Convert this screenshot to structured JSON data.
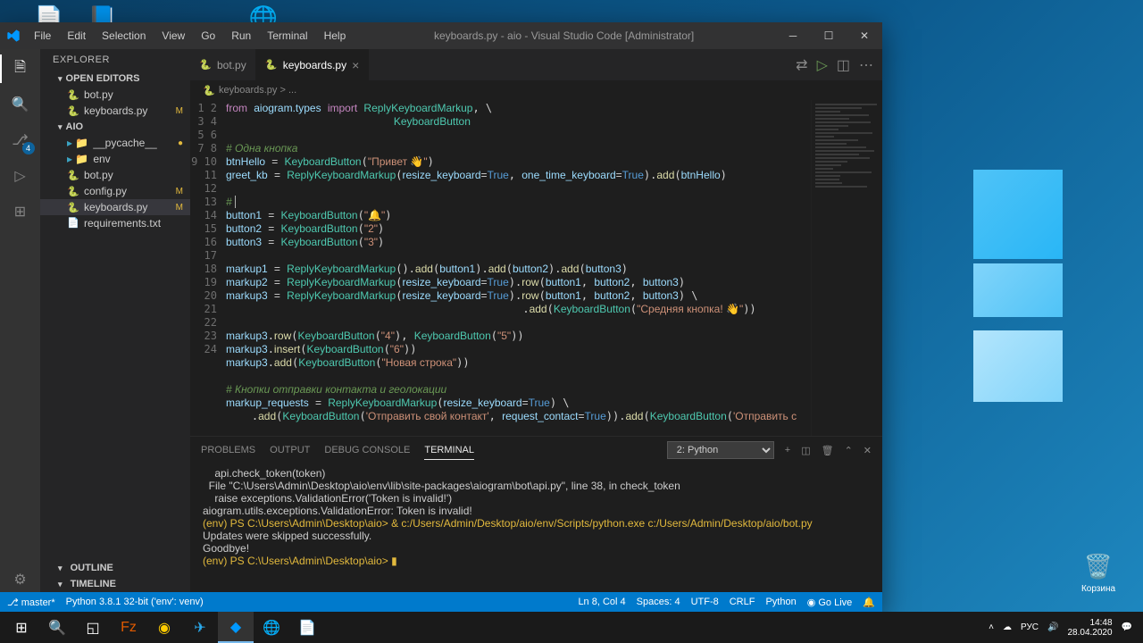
{
  "window": {
    "title": "keyboards.py - aio - Visual Studio Code [Administrator]",
    "menu": [
      "File",
      "Edit",
      "Selection",
      "View",
      "Go",
      "Run",
      "Terminal",
      "Help"
    ]
  },
  "explorer": {
    "title": "EXPLORER",
    "open_editors_label": "OPEN EDITORS",
    "open_editors": [
      {
        "name": "bot.py",
        "status": ""
      },
      {
        "name": "keyboards.py",
        "status": "M"
      }
    ],
    "workspace_label": "AIO",
    "items": [
      {
        "name": "__pycache__",
        "type": "folder",
        "status": "●"
      },
      {
        "name": "env",
        "type": "folder",
        "status": ""
      },
      {
        "name": "bot.py",
        "type": "py",
        "status": ""
      },
      {
        "name": "config.py",
        "type": "py",
        "status": "M"
      },
      {
        "name": "keyboards.py",
        "type": "py",
        "status": "M",
        "selected": true
      },
      {
        "name": "requirements.txt",
        "type": "txt",
        "status": ""
      }
    ],
    "outline": "OUTLINE",
    "timeline": "TIMELINE",
    "scm_badge": "4"
  },
  "tabs": [
    {
      "name": "bot.py",
      "active": false
    },
    {
      "name": "keyboards.py",
      "active": true
    }
  ],
  "breadcrumb": "keyboards.py > ...",
  "code_lines": [
    {
      "n": 1,
      "html": "<span class='kw'>from</span> <span class='var'>aiogram.types</span> <span class='kw'>import</span> <span class='cls'>ReplyKeyboardMarkup</span>, \\"
    },
    {
      "n": 2,
      "html": "                          <span class='cls'>KeyboardButton</span>"
    },
    {
      "n": 3,
      "html": ""
    },
    {
      "n": 4,
      "html": "<span class='cmt'># Одна кнопка</span>"
    },
    {
      "n": 5,
      "html": "<span class='var'>btnHello</span> <span class='op'>=</span> <span class='cls'>KeyboardButton</span>(<span class='str'>\"Привет 👋\"</span>)"
    },
    {
      "n": 6,
      "html": "<span class='var'>greet_kb</span> <span class='op'>=</span> <span class='cls'>ReplyKeyboardMarkup</span>(<span class='var'>resize_keyboard</span><span class='op'>=</span><span class='bool'>True</span>, <span class='var'>one_time_keyboard</span><span class='op'>=</span><span class='bool'>True</span>).<span class='fn'>add</span>(<span class='var'>btnHello</span>)"
    },
    {
      "n": 7,
      "html": ""
    },
    {
      "n": 8,
      "html": "<span class='cmt'># </span><span class='cursor'></span>"
    },
    {
      "n": 9,
      "html": "<span class='var'>button1</span> <span class='op'>=</span> <span class='cls'>KeyboardButton</span>(<span class='str'>\"🔔\"</span>)"
    },
    {
      "n": 10,
      "html": "<span class='var'>button2</span> <span class='op'>=</span> <span class='cls'>KeyboardButton</span>(<span class='str'>\"2\"</span>)"
    },
    {
      "n": 11,
      "html": "<span class='var'>button3</span> <span class='op'>=</span> <span class='cls'>KeyboardButton</span>(<span class='str'>\"3\"</span>)"
    },
    {
      "n": 12,
      "html": ""
    },
    {
      "n": 13,
      "html": "<span class='var'>markup1</span> <span class='op'>=</span> <span class='cls'>ReplyKeyboardMarkup</span>().<span class='fn'>add</span>(<span class='var'>button1</span>).<span class='fn'>add</span>(<span class='var'>button2</span>).<span class='fn'>add</span>(<span class='var'>button3</span>)"
    },
    {
      "n": 14,
      "html": "<span class='var'>markup2</span> <span class='op'>=</span> <span class='cls'>ReplyKeyboardMarkup</span>(<span class='var'>resize_keyboard</span><span class='op'>=</span><span class='bool'>True</span>).<span class='fn'>row</span>(<span class='var'>button1</span>, <span class='var'>button2</span>, <span class='var'>button3</span>)"
    },
    {
      "n": 15,
      "html": "<span class='var'>markup3</span> <span class='op'>=</span> <span class='cls'>ReplyKeyboardMarkup</span>(<span class='var'>resize_keyboard</span><span class='op'>=</span><span class='bool'>True</span>).<span class='fn'>row</span>(<span class='var'>button1</span>, <span class='var'>button2</span>, <span class='var'>button3</span>) \\"
    },
    {
      "n": 16,
      "html": "                                              .<span class='fn'>add</span>(<span class='cls'>KeyboardButton</span>(<span class='str'>\"Средняя кнопка! 👋\"</span>))"
    },
    {
      "n": 17,
      "html": ""
    },
    {
      "n": 18,
      "html": "<span class='var'>markup3</span>.<span class='fn'>row</span>(<span class='cls'>KeyboardButton</span>(<span class='str'>\"4\"</span>), <span class='cls'>KeyboardButton</span>(<span class='str'>\"5\"</span>))"
    },
    {
      "n": 19,
      "html": "<span class='var'>markup3</span>.<span class='fn'>insert</span>(<span class='cls'>KeyboardButton</span>(<span class='str'>\"6\"</span>))"
    },
    {
      "n": 20,
      "html": "<span class='var'>markup3</span>.<span class='fn'>add</span>(<span class='cls'>KeyboardButton</span>(<span class='str'>\"Новая строка\"</span>))"
    },
    {
      "n": 21,
      "html": ""
    },
    {
      "n": 22,
      "html": "<span class='cmt'># Кнопки отправки контакта и геолокации</span>"
    },
    {
      "n": 23,
      "html": "<span class='var'>markup_requests</span> <span class='op'>=</span> <span class='cls'>ReplyKeyboardMarkup</span>(<span class='var'>resize_keyboard</span><span class='op'>=</span><span class='bool'>True</span>) \\"
    },
    {
      "n": 24,
      "html": "    .<span class='fn'>add</span>(<span class='cls'>KeyboardButton</span>(<span class='str'>'Отправить свой контакт'</span>, <span class='var'>request_contact</span><span class='op'>=</span><span class='bool'>True</span>)).<span class='fn'>add</span>(<span class='cls'>KeyboardButton</span>(<span class='str'>'Отправить с</span>"
    }
  ],
  "panel": {
    "tabs": [
      "PROBLEMS",
      "OUTPUT",
      "DEBUG CONSOLE",
      "TERMINAL"
    ],
    "active_tab": "TERMINAL",
    "term_selector": "2: Python",
    "terminal_lines": [
      "    api.check_token(token)",
      "  File \"C:\\Users\\Admin\\Desktop\\aio\\env\\lib\\site-packages\\aiogram\\bot\\api.py\", line 38, in check_token",
      "    raise exceptions.ValidationError('Token is invalid!')",
      "aiogram.utils.exceptions.ValidationError: Token is invalid!",
      "(env) PS C:\\Users\\Admin\\Desktop\\aio> & c:/Users/Admin/Desktop/aio/env/Scripts/python.exe c:/Users/Admin/Desktop/aio/bot.py",
      "",
      "Updates were skipped successfully.",
      "Goodbye!",
      "(env) PS C:\\Users\\Admin\\Desktop\\aio> ▮"
    ]
  },
  "status": {
    "left": [
      "⎇ master*",
      "Python 3.8.1 32-bit ('env': venv)"
    ],
    "right": [
      "Ln 8, Col 4",
      "Spaces: 4",
      "UTF-8",
      "CRLF",
      "Python",
      "◉ Go Live",
      "🔔"
    ]
  },
  "taskbar": {
    "clock_time": "14:48",
    "clock_date": "28.04.2020",
    "lang": "РУС",
    "trash_label": "Корзина"
  }
}
